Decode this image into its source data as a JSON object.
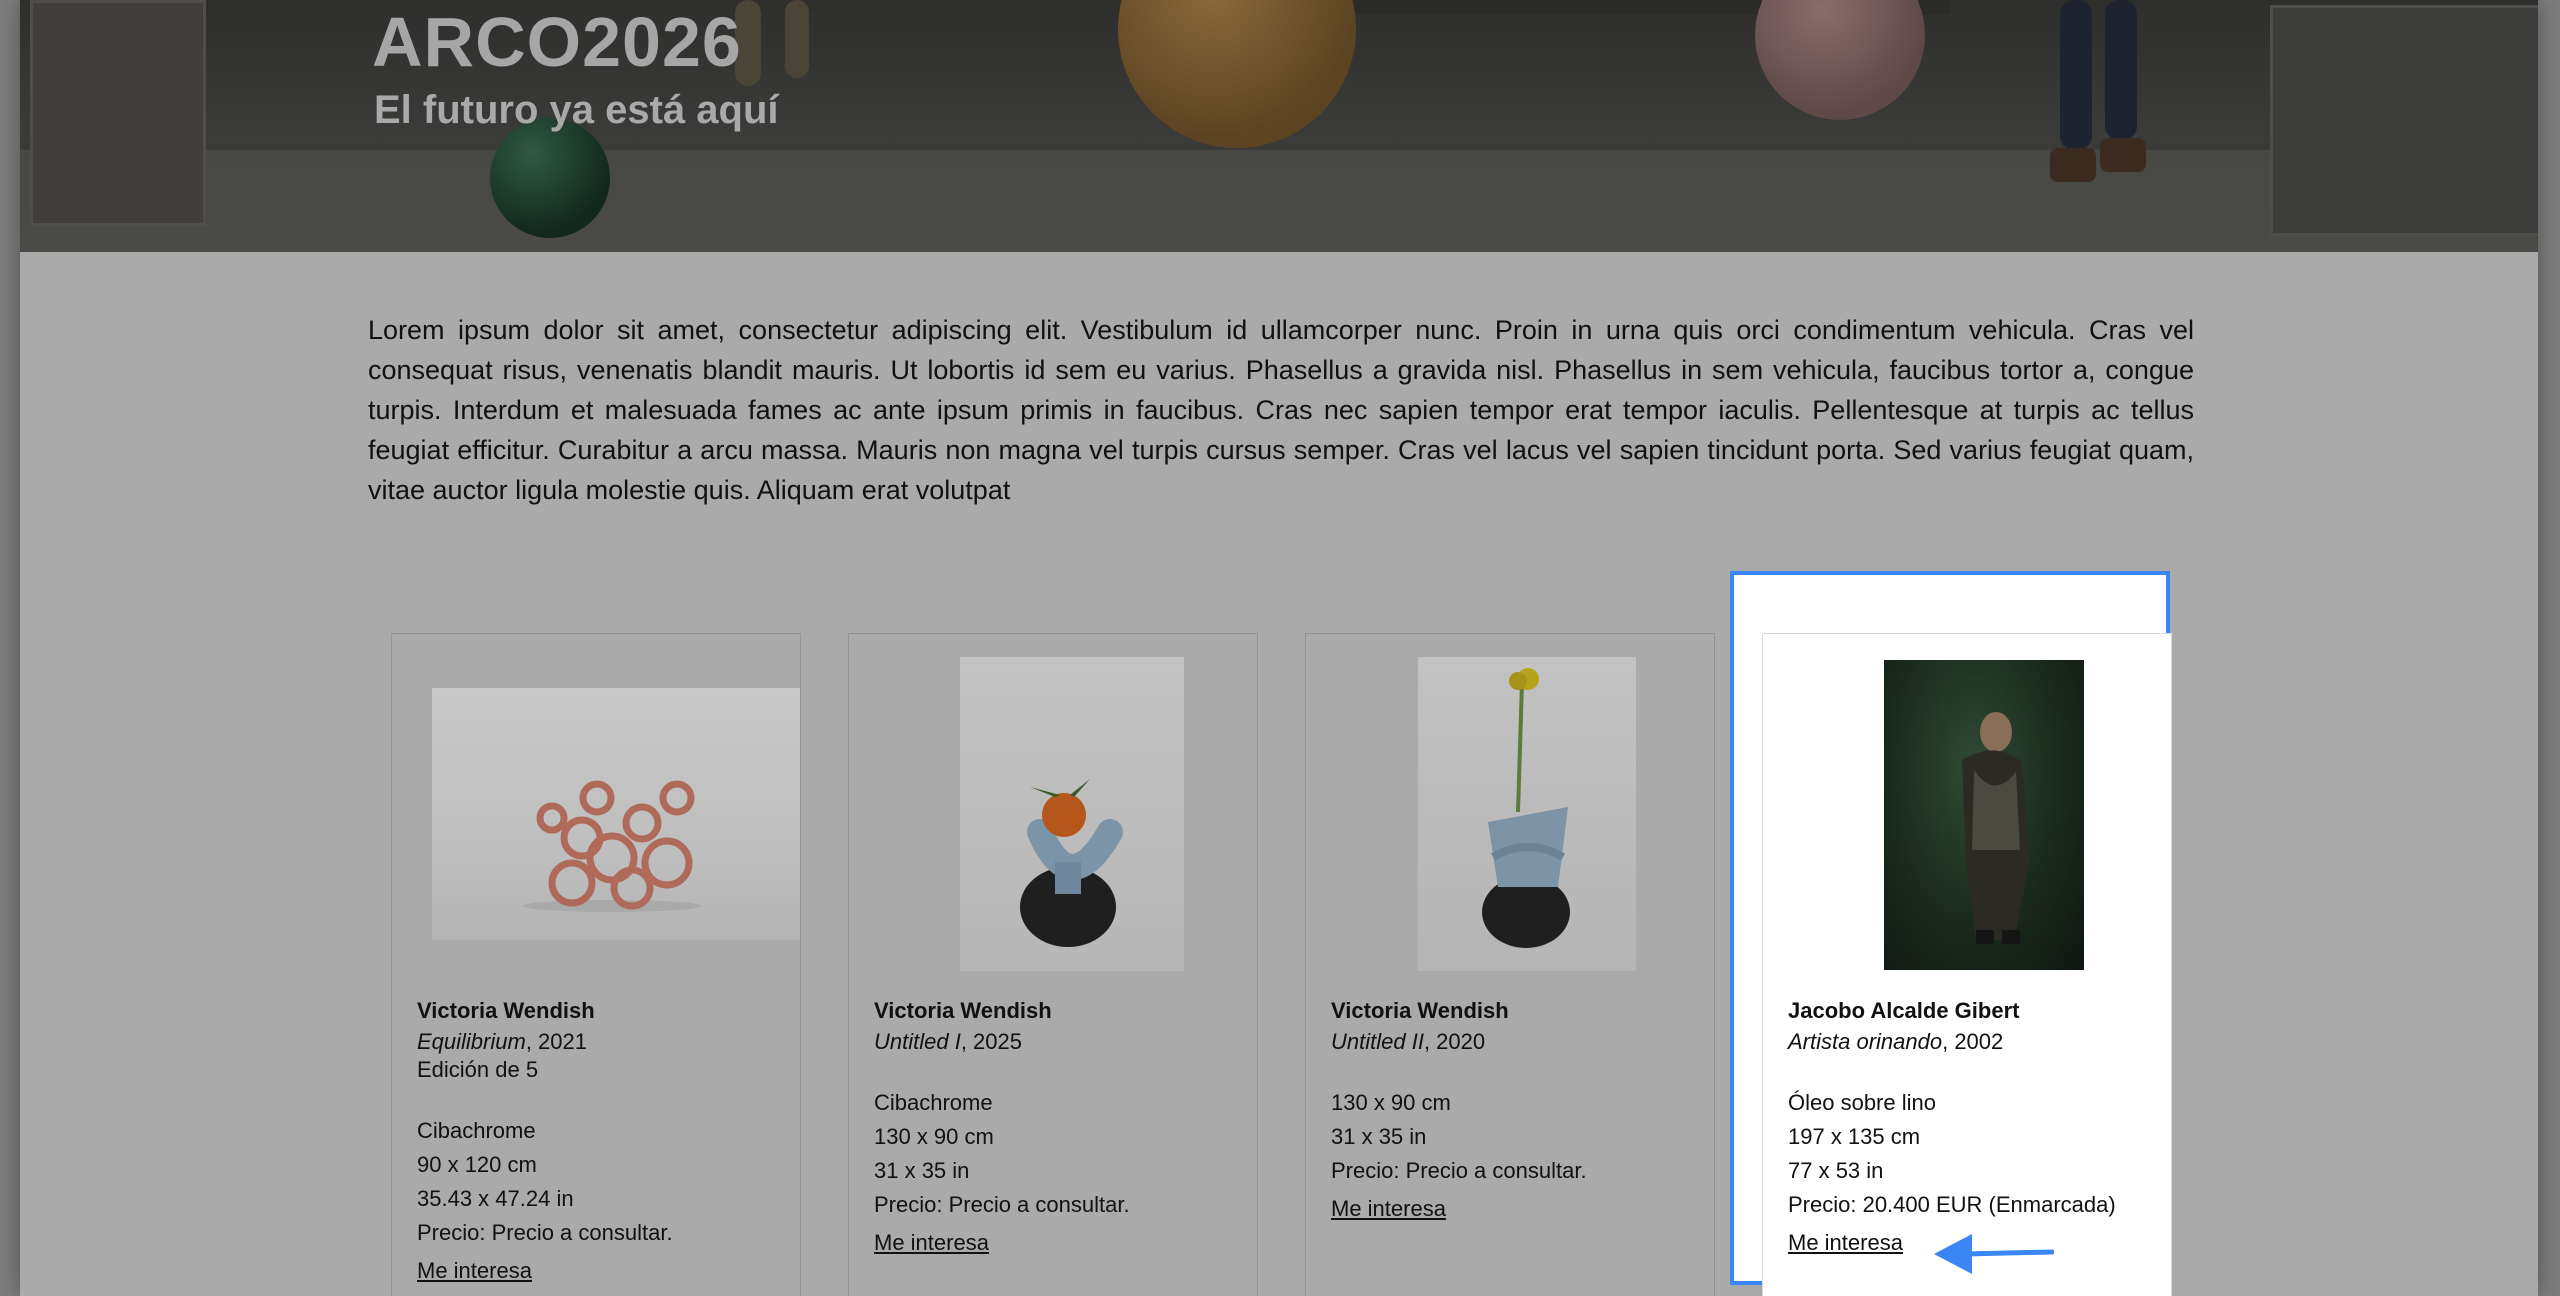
{
  "hero": {
    "title": "ARCO2026",
    "subtitle": "El futuro ya está aquí"
  },
  "intro": {
    "text": "Lorem ipsum dolor sit amet, consectetur adipiscing elit. Vestibulum id ullamcorper nunc. Proin in urna quis orci condimentum vehicula. Cras vel consequat risus, venenatis blandit mauris. Ut lobortis id sem eu varius. Phasellus a gravida nisl. Phasellus in sem vehicula, faucibus tortor a, congue turpis. Interdum et malesuada fames ac ante ipsum primis in faucibus. Cras nec sapien tempor erat tempor iaculis. Pellentesque at turpis ac tellus feugiat efficitur. Curabitur a arcu massa. Mauris non magna vel turpis cursus semper. Cras vel lacus vel sapien tincidunt porta. Sed varius feugiat quam, vitae auctor ligula molestie quis. Aliquam erat volutpat"
  },
  "artworks": [
    {
      "artist": "Victoria Wendish",
      "title": "Equilibrium",
      "year": ", 2021",
      "edition": "Edición de 5",
      "medium": "Cibachrome",
      "dims_cm": "90 x 120 cm",
      "dims_in": "35.43 x 47.24 in",
      "price": "Precio: Precio a consultar.",
      "link": "Me interesa"
    },
    {
      "artist": "Victoria Wendish",
      "title": "Untitled I",
      "year": ", 2025",
      "medium": "Cibachrome",
      "dims_cm": "130 x 90 cm",
      "dims_in": "31 x 35 in",
      "price": "Precio: Precio a consultar.",
      "link": "Me interesa"
    },
    {
      "artist": "Victoria Wendish",
      "title": "Untitled II",
      "year": ", 2020",
      "dims_cm": "130 x 90 cm",
      "dims_in": "31 x 35 in",
      "price": "Precio: Precio a consultar.",
      "link": "Me interesa"
    },
    {
      "artist": "Jacobo Alcalde Gibert",
      "title": "Artista orinando",
      "year": ", 2002",
      "medium": "Óleo sobre lino",
      "dims_cm": "197 x 135 cm",
      "dims_in": "77 x 53 in",
      "price": "Precio: 20.400 EUR (Enmarcada)",
      "link": "Me interesa"
    }
  ],
  "colors": {
    "overlay": "#aaaaaa",
    "highlight_border": "#3a86f4",
    "arrow": "#3a86f4"
  },
  "icons": {
    "annotation": "arrow-left-icon"
  }
}
